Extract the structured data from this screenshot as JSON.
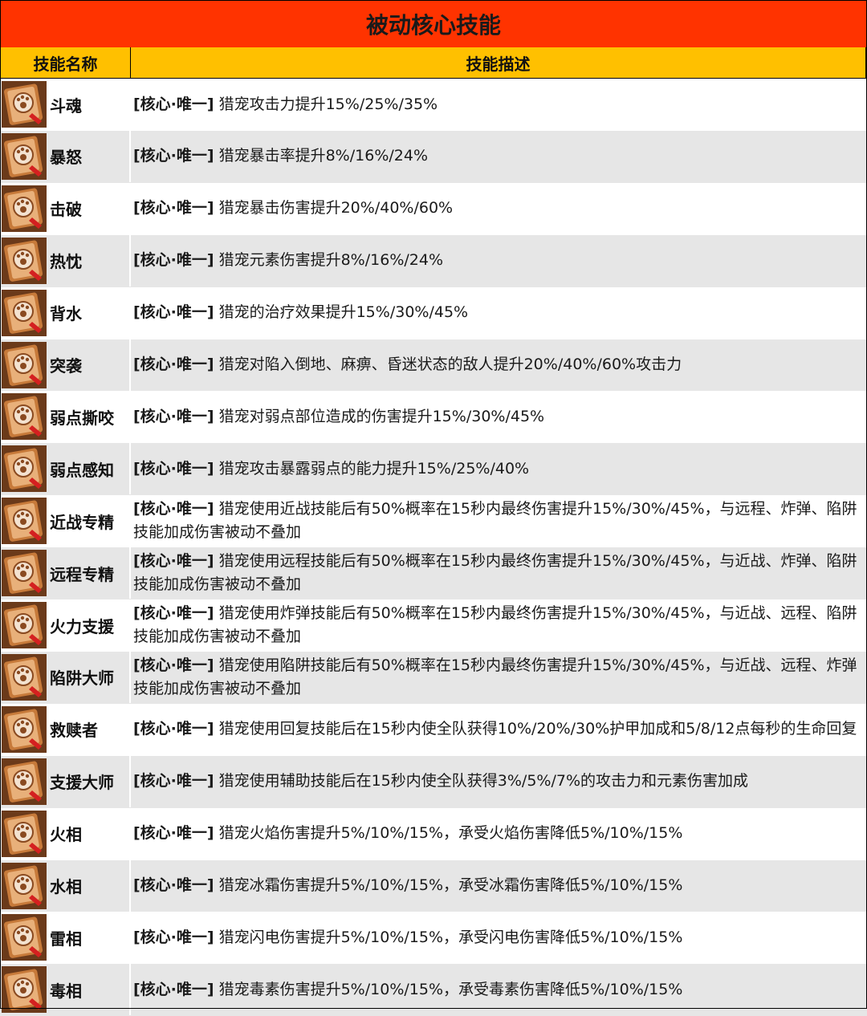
{
  "title": "被动核心技能",
  "headers": {
    "name": "技能名称",
    "description": "技能描述"
  },
  "colors": {
    "title_bg": "#ff3300",
    "header_bg": "#ffc000",
    "row_alt_bg": "#e6e6e6",
    "icon": "scroll-book-icon"
  },
  "tag": "[核心·唯一]",
  "skills": [
    {
      "name": "斗魂",
      "description": "猎宠攻击力提升15%/25%/35%"
    },
    {
      "name": "暴怒",
      "description": "猎宠暴击率提升8%/16%/24%"
    },
    {
      "name": "击破",
      "description": "猎宠暴击伤害提升20%/40%/60%"
    },
    {
      "name": "热忱",
      "description": "猎宠元素伤害提升8%/16%/24%"
    },
    {
      "name": "背水",
      "description": "猎宠的治疗效果提升15%/30%/45%"
    },
    {
      "name": "突袭",
      "description": "猎宠对陷入倒地、麻痹、昏迷状态的敌人提升20%/40%/60%攻击力"
    },
    {
      "name": "弱点撕咬",
      "description": "猎宠对弱点部位造成的伤害提升15%/30%/45%"
    },
    {
      "name": "弱点感知",
      "description": "猎宠攻击暴露弱点的能力提升15%/25%/40%"
    },
    {
      "name": "近战专精",
      "description": "猎宠使用近战技能后有50%概率在15秒内最终伤害提升15%/30%/45%，与远程、炸弹、陷阱技能加成伤害被动不叠加"
    },
    {
      "name": "远程专精",
      "description": "猎宠使用远程技能后有50%概率在15秒内最终伤害提升15%/30%/45%，与近战、炸弹、陷阱技能加成伤害被动不叠加"
    },
    {
      "name": "火力支援",
      "description": "猎宠使用炸弹技能后有50%概率在15秒内最终伤害提升15%/30%/45%，与近战、远程、陷阱技能加成伤害被动不叠加"
    },
    {
      "name": "陷阱大师",
      "description": "猎宠使用陷阱技能后有50%概率在15秒内最终伤害提升15%/30%/45%，与近战、远程、炸弹技能加成伤害被动不叠加"
    },
    {
      "name": "救赎者",
      "description": "猎宠使用回复技能后在15秒内使全队获得10%/20%/30%护甲加成和5/8/12点每秒的生命回复"
    },
    {
      "name": "支援大师",
      "description": "猎宠使用辅助技能后在15秒内使全队获得3%/5%/7%的攻击力和元素伤害加成"
    },
    {
      "name": "火相",
      "description": "猎宠火焰伤害提升5%/10%/15%，承受火焰伤害降低5%/10%/15%"
    },
    {
      "name": "水相",
      "description": "猎宠冰霜伤害提升5%/10%/15%，承受冰霜伤害降低5%/10%/15%"
    },
    {
      "name": "雷相",
      "description": "猎宠闪电伤害提升5%/10%/15%，承受闪电伤害降低5%/10%/15%"
    },
    {
      "name": "毒相",
      "description": "猎宠毒素伤害提升5%/10%/15%，承受毒素伤害降低5%/10%/15%"
    }
  ]
}
